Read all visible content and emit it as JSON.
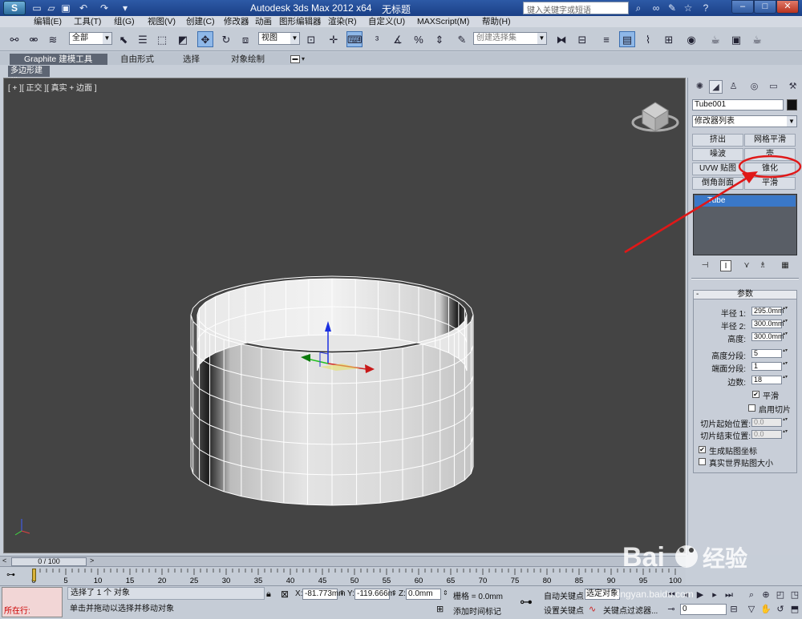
{
  "titlebar": {
    "title": "Autodesk 3ds Max  2012 x64",
    "file": "无标题",
    "search_placeholder": "键入关键字或短语"
  },
  "menu": [
    "编辑(E)",
    "工具(T)",
    "组(G)",
    "视图(V)",
    "创建(C)",
    "修改器",
    "动画",
    "图形编辑器",
    "渲染(R)",
    "自定义(U)",
    "MAXScript(M)",
    "帮助(H)"
  ],
  "toolbar": {
    "selection_filter": "全部",
    "ref_coord": "视图",
    "named_selection": "创建选择集"
  },
  "ribbon": {
    "tabs": [
      "Graphite 建模工具",
      "自由形式",
      "选择",
      "对象绘制"
    ],
    "subtab": "多边形建模"
  },
  "viewport": {
    "label": "[ + ][ 正交 ][ 真实 + 边面 ]"
  },
  "command_panel": {
    "object_name": "Tube001",
    "modifier_list": "修改器列表",
    "modifier_buttons": [
      "挤出",
      "网格平滑",
      "噪波",
      "壳",
      "UVW 贴图",
      "锥化",
      "倒角剖面",
      "平滑"
    ],
    "stack_item": "Tube",
    "rollout_title": "参数",
    "params": [
      {
        "label": "半径 1:",
        "value": "295.0mm"
      },
      {
        "label": "半径 2:",
        "value": "300.0mm"
      },
      {
        "label": "高度:",
        "value": "300.0mm"
      },
      {
        "label": "高度分段:",
        "value": "5"
      },
      {
        "label": "端面分段:",
        "value": "1"
      },
      {
        "label": "边数:",
        "value": "18"
      }
    ],
    "smooth_label": "平滑",
    "slice_on_label": "启用切片",
    "slice_from_label": "切片起始位置:",
    "slice_from_value": "0.0",
    "slice_to_label": "切片结束位置:",
    "slice_to_value": "0.0",
    "gen_map_label": "生成贴图坐标",
    "real_world_label": "真实世界贴图大小"
  },
  "timeline": {
    "slider_text": "0 / 100",
    "ticks": [
      "0",
      "5",
      "10",
      "15",
      "20",
      "25",
      "30",
      "35",
      "40",
      "45",
      "50",
      "55",
      "60",
      "65",
      "70",
      "75",
      "80",
      "85",
      "90",
      "95",
      "100"
    ]
  },
  "status": {
    "maxscript": "所在行:",
    "line1": "选择了 1 个 对象",
    "line2": "单击并拖动以选择并移动对象",
    "x_label": "X:",
    "x_value": "-81.773mm",
    "y_label": "Y:",
    "y_value": "-119.666m",
    "z_label": "Z:",
    "z_value": "0.0mm",
    "grid": "栅格 = 0.0mm",
    "add_time_tag": "添加时间标记",
    "auto_key": "自动关键点",
    "set_key": "设置关键点",
    "selected": "选定对象",
    "key_filters": "关键点过滤器...",
    "frame": "0"
  },
  "watermark": {
    "text": "jingyan.baidu.com",
    "logo": "Bai 经验"
  },
  "colors": {
    "viewport_bg": "#444444",
    "annotation": "#e01818",
    "stack_selected": "#3a78c8"
  }
}
